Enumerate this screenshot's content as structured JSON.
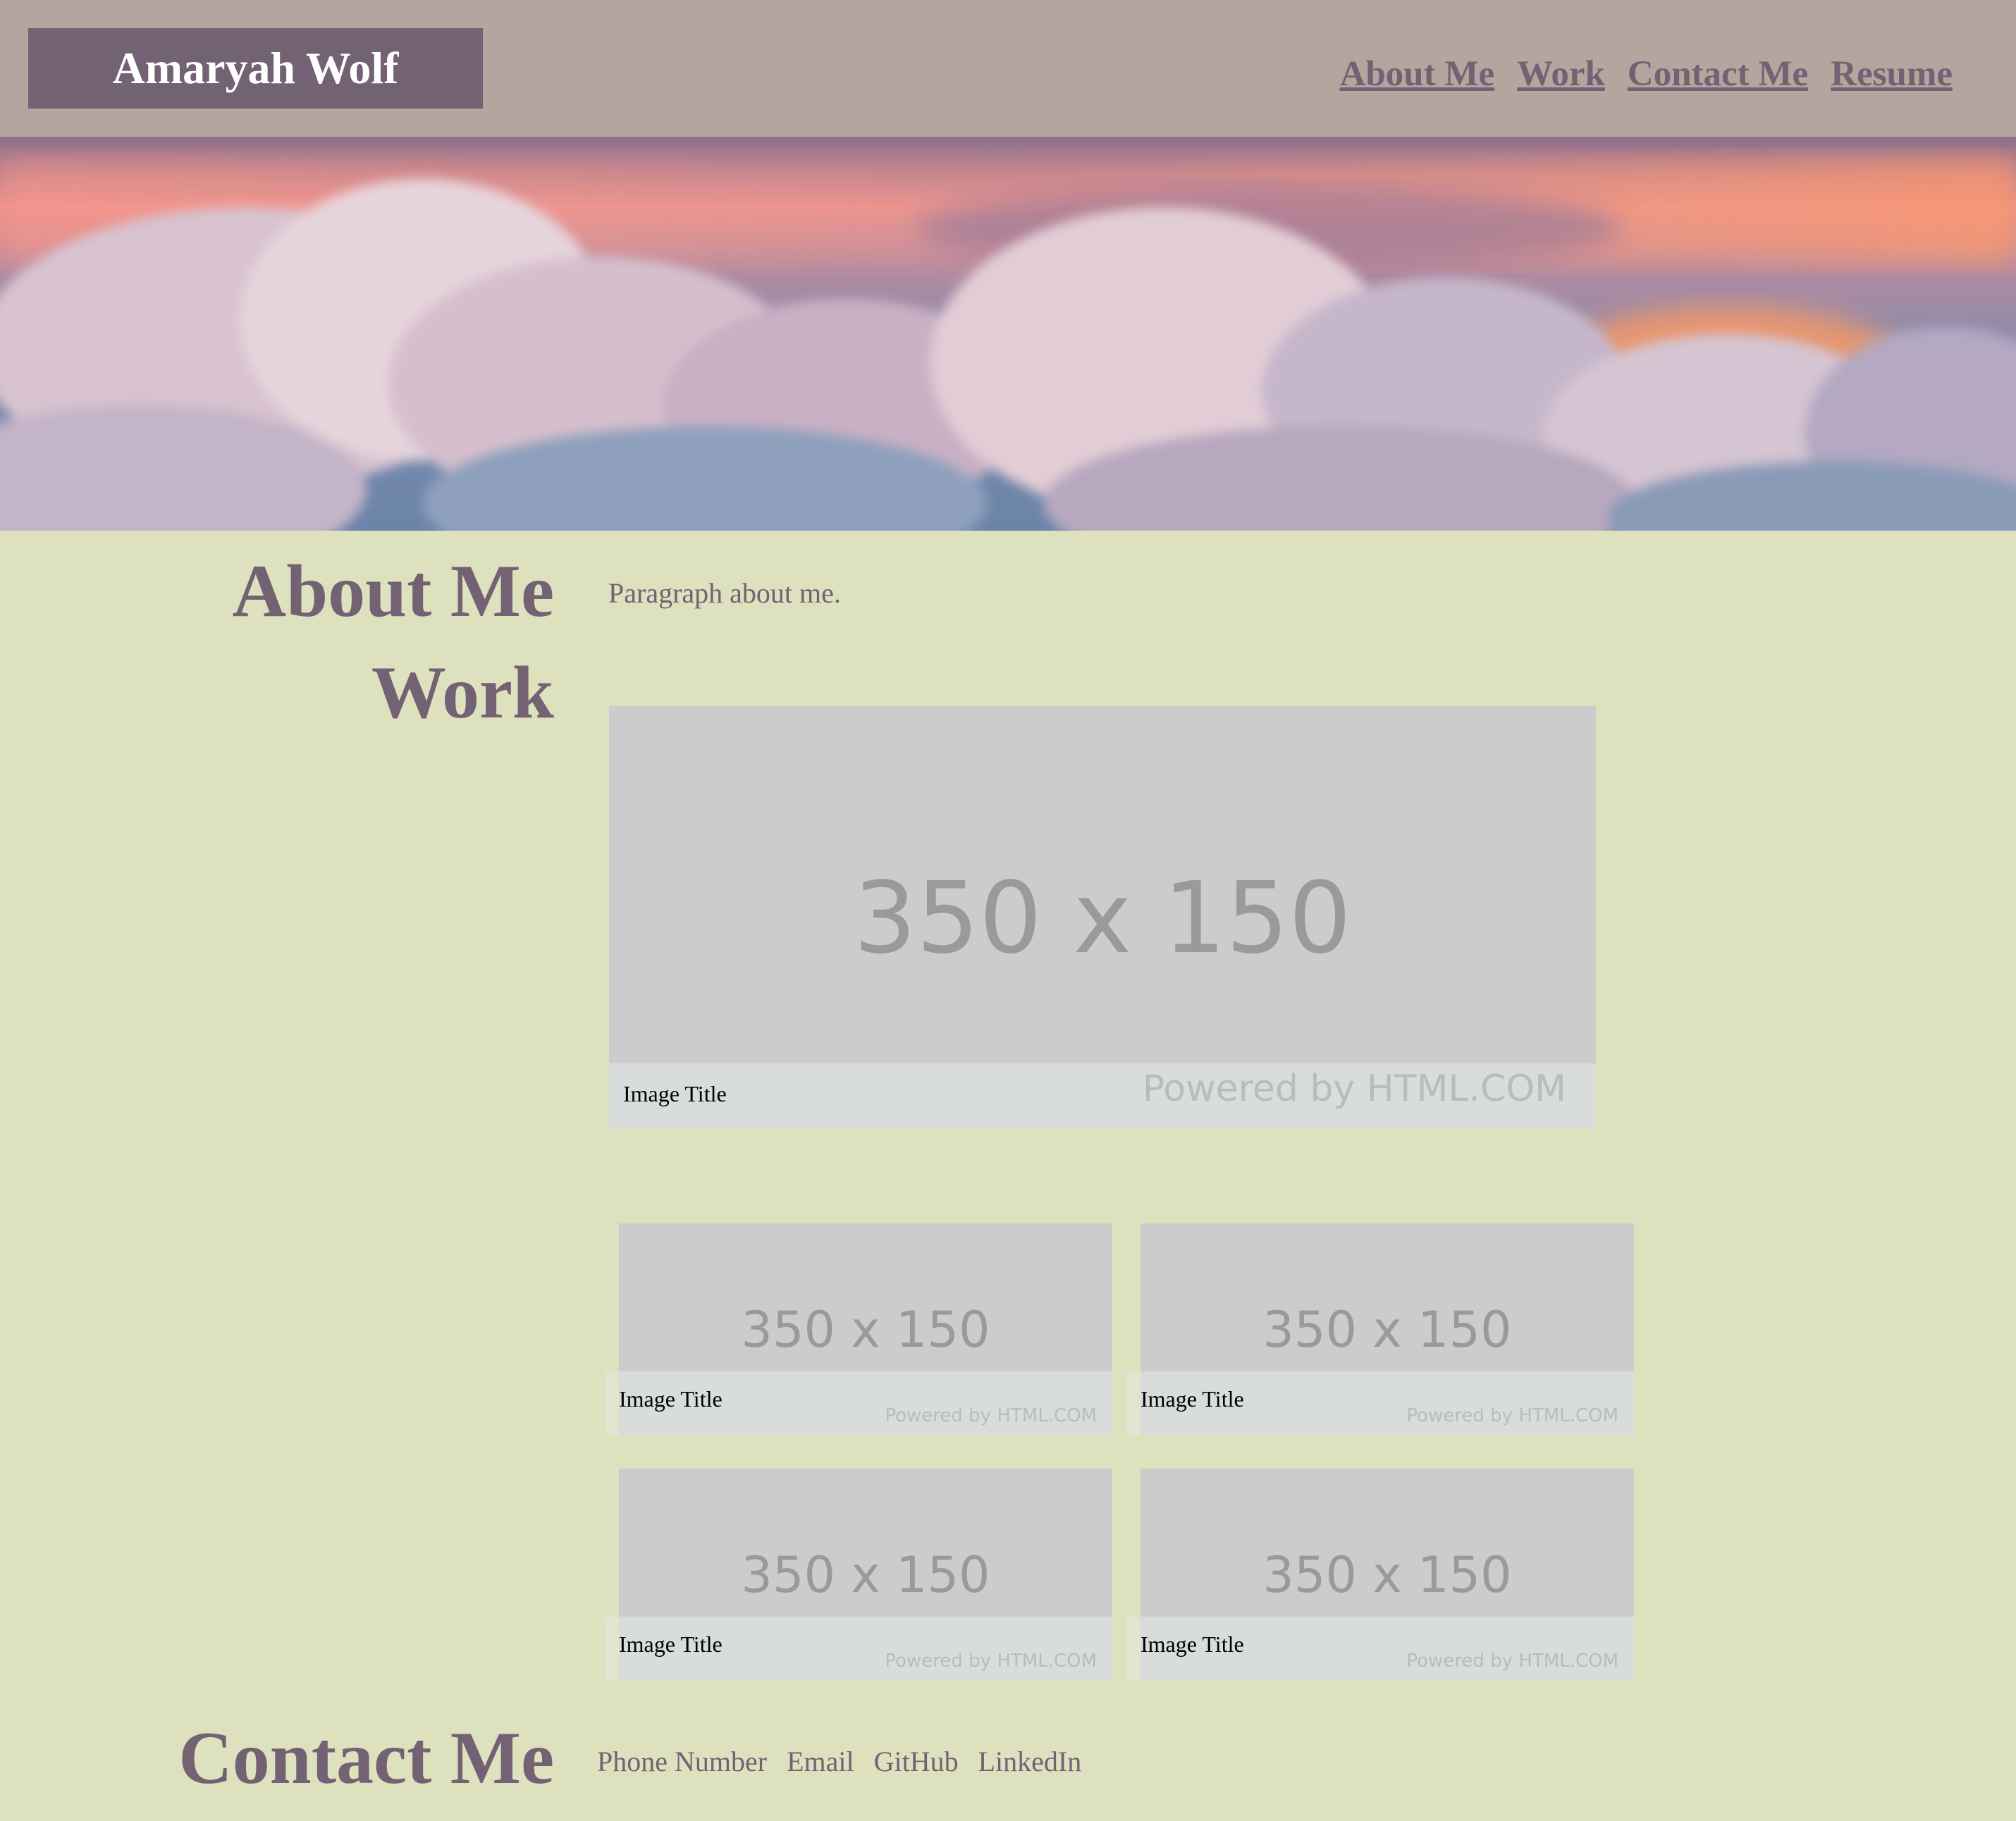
{
  "header": {
    "brand": "Amaryah Wolf",
    "nav": [
      "About Me",
      "Work",
      "Contact Me",
      "Resume"
    ]
  },
  "about": {
    "title": "About Me",
    "paragraph": "Paragraph about me."
  },
  "work": {
    "title": "Work",
    "featured": {
      "placeholder": "350 x 150",
      "caption": "Image Title",
      "powered_by": "Powered by HTML.COM"
    },
    "grid": [
      {
        "placeholder": "350 x 150",
        "caption": "Image Title",
        "powered_by": "Powered by HTML.COM"
      },
      {
        "placeholder": "350 x 150",
        "caption": "Image Title",
        "powered_by": "Powered by HTML.COM"
      },
      {
        "placeholder": "350 x 150",
        "caption": "Image Title",
        "powered_by": "Powered by HTML.COM"
      },
      {
        "placeholder": "350 x 150",
        "caption": "Image Title",
        "powered_by": "Powered by HTML.COM"
      }
    ]
  },
  "contact": {
    "title": "Contact Me",
    "links": [
      "Phone Number",
      "Email",
      "GitHub",
      "LinkedIn"
    ]
  },
  "colors": {
    "header_bg": "#b6a49f",
    "brand_bg": "#736273",
    "accent": "#736273",
    "page_bg": "#dde1bd",
    "placeholder_bg": "#cccccc"
  }
}
